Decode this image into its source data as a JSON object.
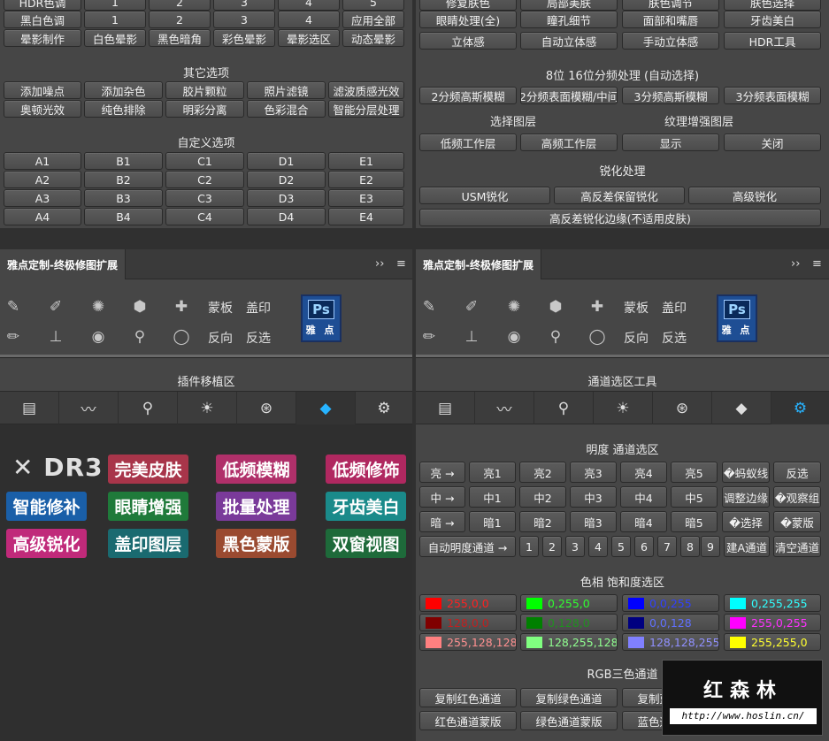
{
  "tl": {
    "row0": [
      "HDR色调",
      "1",
      "2",
      "3",
      "4",
      "5"
    ],
    "row1": [
      "黑白色调",
      "1",
      "2",
      "3",
      "4",
      "应用全部"
    ],
    "row2": [
      "晕影制作",
      "白色晕影",
      "黑色暗角",
      "彩色晕影",
      "晕影选区",
      "动态晕影"
    ],
    "other_title": "其它选项",
    "other_r1": [
      "添加噪点",
      "添加杂色",
      "胶片颗粒",
      "照片滤镜",
      "滤波质感光效"
    ],
    "other_r2": [
      "奥顿光效",
      "纯色排除",
      "明彩分离",
      "色彩混合",
      "智能分层处理"
    ],
    "custom_title": "自定义选项",
    "custom": [
      [
        "A1",
        "B1",
        "C1",
        "D1",
        "E1"
      ],
      [
        "A2",
        "B2",
        "C2",
        "D2",
        "E2"
      ],
      [
        "A3",
        "B3",
        "C3",
        "D3",
        "E3"
      ],
      [
        "A4",
        "B4",
        "C4",
        "D4",
        "E4"
      ]
    ]
  },
  "tr": {
    "row0": [
      "修复肤色",
      "局部美肤",
      "肤色调节",
      "肤色选择"
    ],
    "row1": [
      "眼睛处理(全)",
      "瞳孔细节",
      "面部和嘴唇",
      "牙齿美白"
    ],
    "row2": [
      "立体感",
      "自动立体感",
      "手动立体感",
      "HDR工具"
    ],
    "freq_title": "8位 16位分频处理 (自动选择)",
    "freq": [
      "2分频高斯模糊",
      "2分频表面模糊/中间",
      "3分频高斯模糊",
      "3分频表面模糊"
    ],
    "sel_layer": "选择图层",
    "tex_layer": "纹理增强图层",
    "layers": [
      "低频工作层",
      "高频工作层",
      "显示",
      "关闭"
    ],
    "sharpen_title": "锐化处理",
    "sharpen": [
      "USM锐化",
      "高反差保留锐化",
      "高级锐化"
    ],
    "sharpen_wide": "高反差锐化边缘(不适用皮肤)"
  },
  "left_panel": {
    "tab": "雅点定制-终极修图扩展",
    "overflow": "››",
    "menu": "≡",
    "tools_text": [
      "蒙板",
      "盖印",
      "反向",
      "反选"
    ],
    "ps": "Ps",
    "ps_sub": "雅 点",
    "section": "插件移植区",
    "logo": "DR3",
    "big": [
      {
        "label": "完美皮肤",
        "color": "#a8354a"
      },
      {
        "label": "低频模糊",
        "color": "#b0306a"
      },
      {
        "label": "低频修饰",
        "color": "#b02860"
      },
      {
        "label": "智能修补",
        "color": "#1a5fa8"
      },
      {
        "label": "眼睛增强",
        "color": "#1f7a3a"
      },
      {
        "label": "批量处理",
        "color": "#7a3a9a"
      },
      {
        "label": "牙齿美白",
        "color": "#1a8a8a"
      },
      {
        "label": "高级锐化",
        "color": "#c02a7a"
      },
      {
        "label": "盖印图层",
        "color": "#1a6a70"
      },
      {
        "label": "黑色蒙版",
        "color": "#9a4a30"
      },
      {
        "label": "双窗视图",
        "color": "#1e6a3a"
      }
    ]
  },
  "right_panel": {
    "tab": "雅点定制-终极修图扩展",
    "overflow": "››",
    "menu": "≡",
    "tools_text": [
      "蒙板",
      "盖印",
      "反向",
      "反选"
    ],
    "ps": "Ps",
    "ps_sub": "雅 点",
    "section": "通道选区工具",
    "lum_title": "明度 通道选区",
    "lum_rows": [
      [
        "亮 →",
        "亮1",
        "亮2",
        "亮3",
        "亮4",
        "亮5",
        "�蚂蚁线",
        "反选"
      ],
      [
        "中 →",
        "中1",
        "中2",
        "中3",
        "中4",
        "中5",
        "调整边缘",
        "�观察组"
      ],
      [
        "暗 →",
        "暗1",
        "暗2",
        "暗3",
        "暗4",
        "暗5",
        "�选择",
        "�蒙版"
      ]
    ],
    "auto_lum": "自动明度通道 →",
    "nums": [
      "1",
      "2",
      "3",
      "4",
      "5",
      "6",
      "7",
      "8",
      "9"
    ],
    "build_a": "建A通道",
    "clear": "清空通道",
    "hue_title": "色相 饱和度选区",
    "colors": [
      {
        "label": "255,0,0",
        "sw": "#ff0000",
        "tc": "#ff2020"
      },
      {
        "label": "0,255,0",
        "sw": "#00ff00",
        "tc": "#30ff30"
      },
      {
        "label": "0,0,255",
        "sw": "#0000ff",
        "tc": "#3040ff"
      },
      {
        "label": "0,255,255",
        "sw": "#00ffff",
        "tc": "#30ffff"
      },
      {
        "label": "128,0,0",
        "sw": "#800000",
        "tc": "#c02020"
      },
      {
        "label": "0,128,0",
        "sw": "#008000",
        "tc": "#209020"
      },
      {
        "label": "0,0,128",
        "sw": "#000080",
        "tc": "#6070ff"
      },
      {
        "label": "255,0,255",
        "sw": "#ff00ff",
        "tc": "#ff30ff"
      },
      {
        "label": "255,128,128",
        "sw": "#ff8080",
        "tc": "#ff9090"
      },
      {
        "label": "128,255,128",
        "sw": "#80ff80",
        "tc": "#90ff90"
      },
      {
        "label": "128,128,255",
        "sw": "#8080ff",
        "tc": "#9090ff"
      },
      {
        "label": "255,255,0",
        "sw": "#ffff00",
        "tc": "#ffff30"
      }
    ],
    "rgb_title": "RGB三色通道",
    "rgb_r1": [
      "复制红色通道",
      "复制绿色通道",
      "复制蓝色通道"
    ],
    "rgb_r2": [
      "红色通道蒙版",
      "绿色通道蒙版",
      "蓝色通道蒙版"
    ]
  },
  "watermark": {
    "title": "红森林",
    "url": "http://www.hoslin.cn/"
  }
}
